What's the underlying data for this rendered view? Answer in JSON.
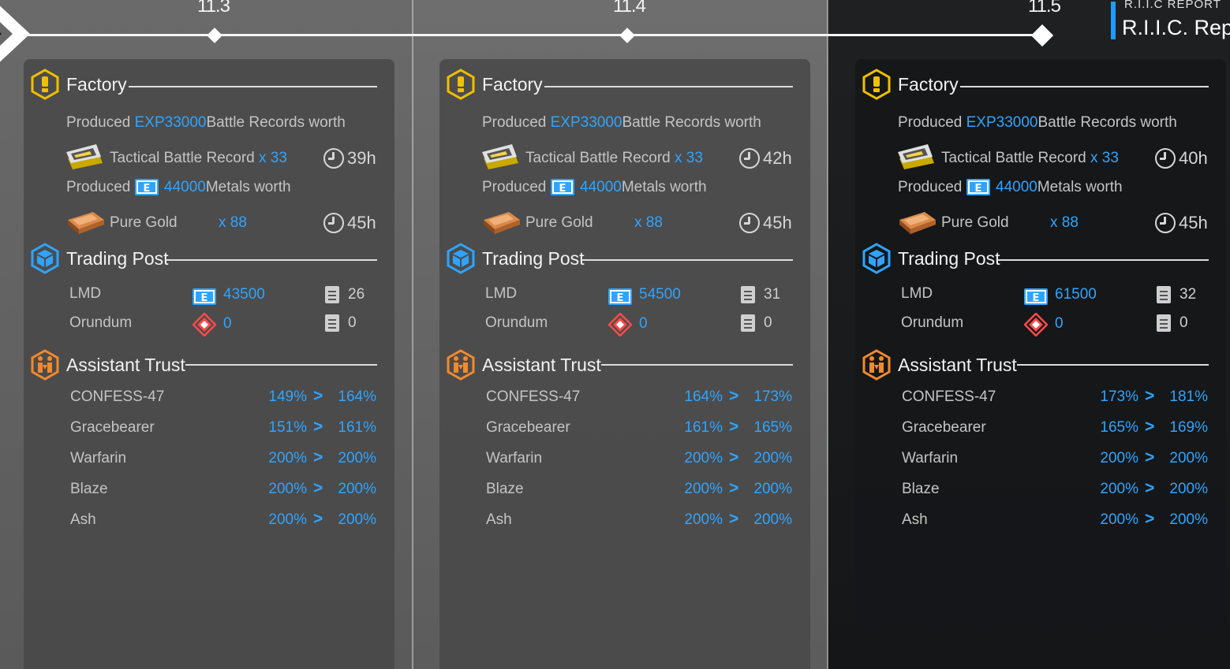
{
  "header": {
    "report_small": "R.I.I.C REPORT",
    "report_big": "R.I.I.C. Repor"
  },
  "colors": {
    "accent": "#2fa4ff",
    "factory_icon": "#f0c000",
    "trading_icon": "#2fa4ff",
    "trust_icon": "#f08a30"
  },
  "labels": {
    "factory": "Factory",
    "trading": "Trading Post",
    "trust": "Assistant Trust",
    "produced": "Produced",
    "battle_value": "EXP33000",
    "battle_suffix": "Battle Records worth",
    "metals_value": "44000",
    "metals_suffix": "Metals worth",
    "tactical": "Tactical Battle Record",
    "tactical_qty": "x 33",
    "gold": "Pure Gold",
    "gold_qty": "x 88",
    "lmd": "LMD",
    "orundum": "Orundum"
  },
  "columns": [
    {
      "date": "11.3",
      "factory": {
        "tactical_time": "39h",
        "gold_time": "45h"
      },
      "trading": {
        "lmd": "43500",
        "lmd_orders": "26",
        "orundum": "0",
        "orundum_orders": "0"
      },
      "trust": [
        {
          "name": "CONFESS-47",
          "from": "149%",
          "to": "164%"
        },
        {
          "name": "Gracebearer",
          "from": "151%",
          "to": "161%"
        },
        {
          "name": "Warfarin",
          "from": "200%",
          "to": "200%"
        },
        {
          "name": "Blaze",
          "from": "200%",
          "to": "200%"
        },
        {
          "name": "Ash",
          "from": "200%",
          "to": "200%"
        }
      ]
    },
    {
      "date": "11.4",
      "factory": {
        "tactical_time": "42h",
        "gold_time": "45h"
      },
      "trading": {
        "lmd": "54500",
        "lmd_orders": "31",
        "orundum": "0",
        "orundum_orders": "0"
      },
      "trust": [
        {
          "name": "CONFESS-47",
          "from": "164%",
          "to": "173%"
        },
        {
          "name": "Gracebearer",
          "from": "161%",
          "to": "165%"
        },
        {
          "name": "Warfarin",
          "from": "200%",
          "to": "200%"
        },
        {
          "name": "Blaze",
          "from": "200%",
          "to": "200%"
        },
        {
          "name": "Ash",
          "from": "200%",
          "to": "200%"
        }
      ]
    },
    {
      "date": "11.5",
      "factory": {
        "tactical_time": "40h",
        "gold_time": "45h"
      },
      "trading": {
        "lmd": "61500",
        "lmd_orders": "32",
        "orundum": "0",
        "orundum_orders": "0"
      },
      "trust": [
        {
          "name": "CONFESS-47",
          "from": "173%",
          "to": "181%"
        },
        {
          "name": "Gracebearer",
          "from": "165%",
          "to": "169%"
        },
        {
          "name": "Warfarin",
          "from": "200%",
          "to": "200%"
        },
        {
          "name": "Blaze",
          "from": "200%",
          "to": "200%"
        },
        {
          "name": "Ash",
          "from": "200%",
          "to": "200%"
        }
      ]
    }
  ]
}
